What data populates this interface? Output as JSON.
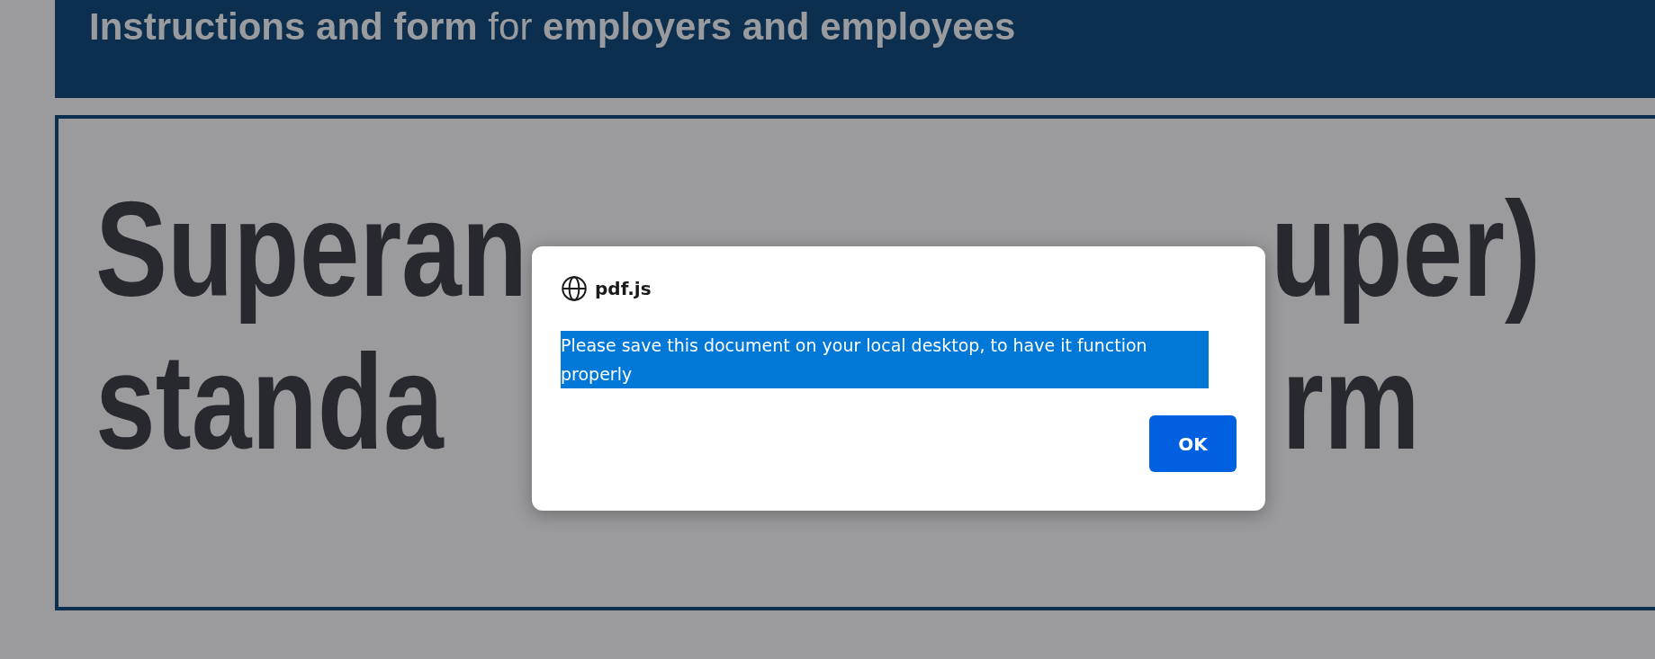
{
  "banner": {
    "subtitle": "**Instructions and form** for **employers and employees**"
  },
  "heading": {
    "lines": [
      {
        "left": "Superan",
        "right": "uper)"
      },
      {
        "left": "standa",
        "right": "rm"
      }
    ]
  },
  "dialog": {
    "title": "pdf.js",
    "message": "Please save this document on your local desktop, to have it function properly",
    "message_selected": true,
    "buttons": [
      "OK"
    ]
  }
}
